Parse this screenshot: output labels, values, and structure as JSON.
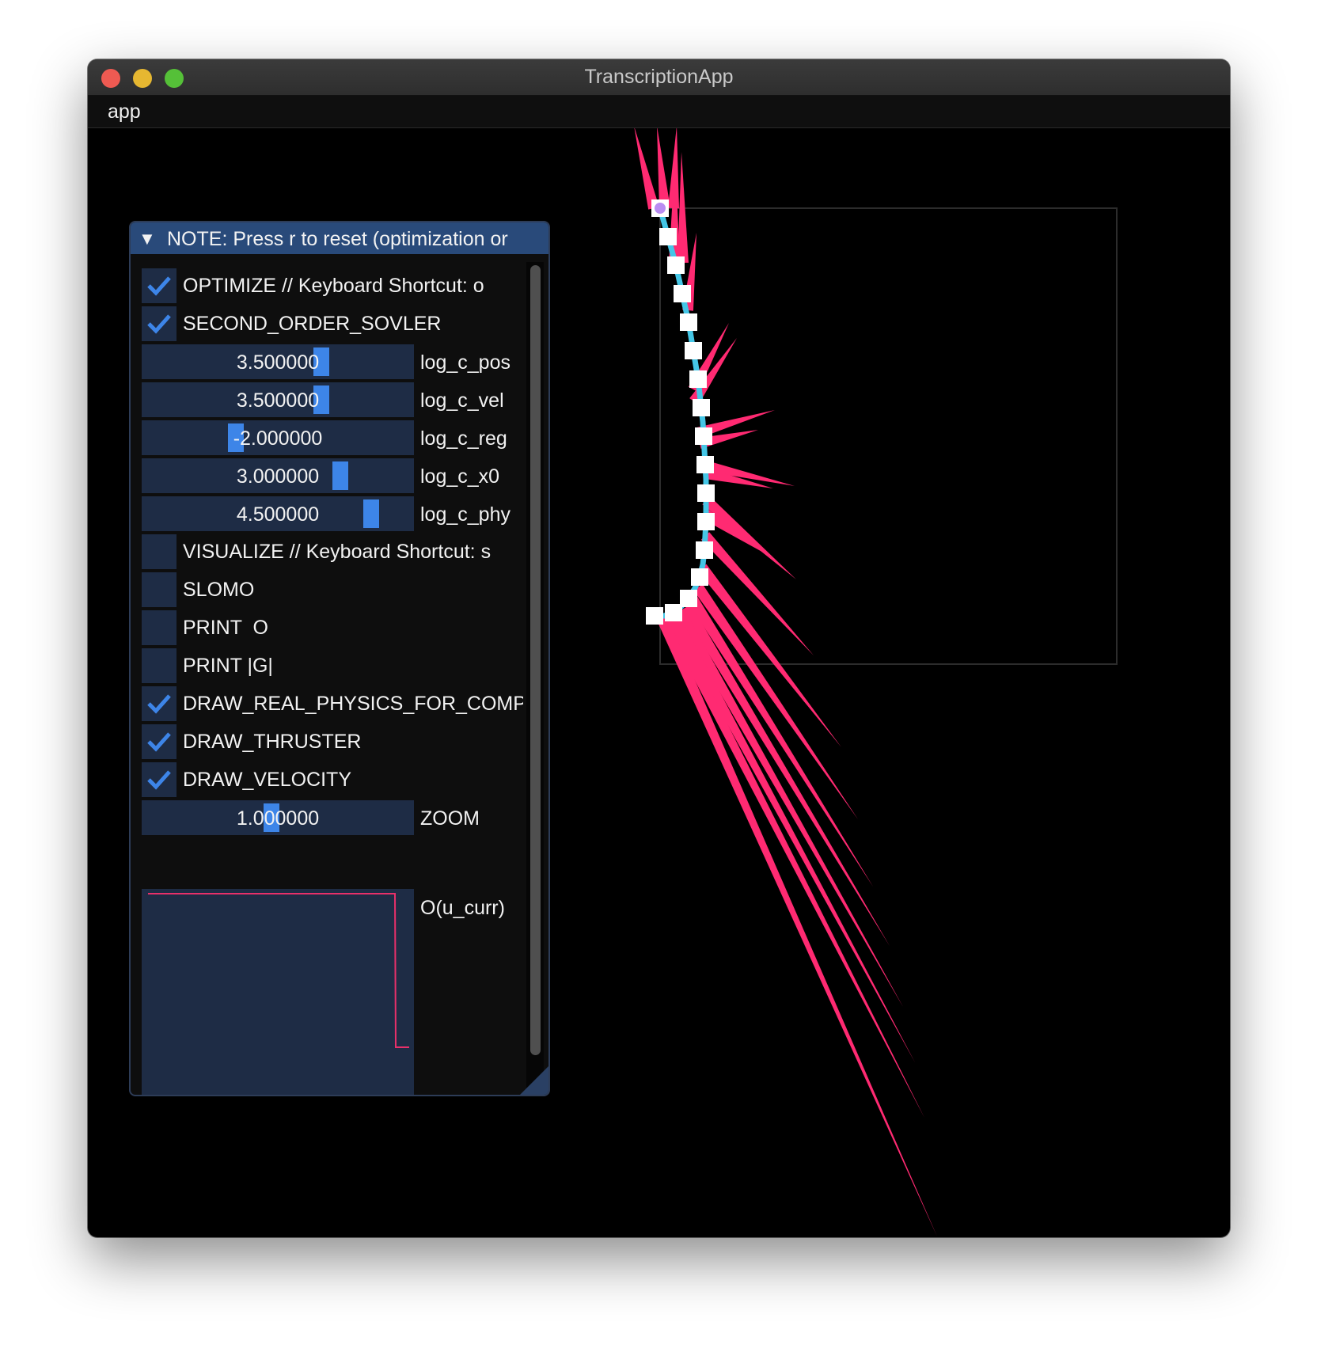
{
  "window": {
    "title": "TranscriptionApp"
  },
  "menu": {
    "items": [
      "app"
    ]
  },
  "panel": {
    "title": "NOTE: Press r to reset (optimization or",
    "checkboxes": [
      {
        "label": "OPTIMIZE // Keyboard Shortcut: o",
        "checked": true
      },
      {
        "label": "SECOND_ORDER_SOVLER",
        "checked": true
      },
      {
        "label": "VISUALIZE // Keyboard Shortcut: s",
        "checked": false
      },
      {
        "label": "SLOMO",
        "checked": false
      },
      {
        "label": "PRINT  O",
        "checked": false
      },
      {
        "label": "PRINT |G|",
        "checked": false
      },
      {
        "label": "DRAW_REAL_PHYSICS_FOR_COMPARISON",
        "checked": true
      },
      {
        "label": "DRAW_THRUSTER",
        "checked": true
      },
      {
        "label": "DRAW_VELOCITY",
        "checked": true
      }
    ],
    "sliders": [
      {
        "label": "log_c_pos",
        "value": "3.500000",
        "level": 0.67
      },
      {
        "label": "log_c_vel",
        "value": "3.500000",
        "level": 0.67
      },
      {
        "label": "log_c_reg",
        "value": "-2.000000",
        "level": 0.32
      },
      {
        "label": "log_c_x0",
        "value": "3.000000",
        "level": 0.74
      },
      {
        "label": "log_c_phy",
        "value": "4.500000",
        "level": 0.86
      },
      {
        "label": "ZOOM",
        "value": "1.000000",
        "level": 0.45
      }
    ],
    "plot": {
      "label": "O(u_curr)",
      "line_color": "#e8306a"
    }
  },
  "colors": {
    "accent": "#3d85e8",
    "thruster": "#ff2a72",
    "velocity": "#45c6e6",
    "trajectory_marker": "#ffffff",
    "goal_marker": "#b98cf2"
  }
}
